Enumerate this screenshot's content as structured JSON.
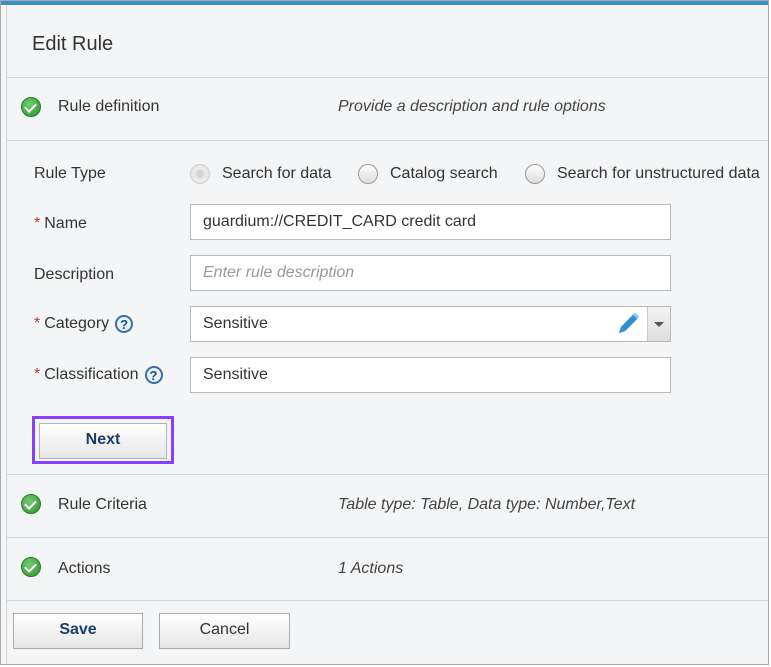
{
  "dialog": {
    "title": "Edit Rule"
  },
  "sections": [
    {
      "label": "Rule definition",
      "description": "Provide a description and rule options"
    },
    {
      "label": "Rule Criteria",
      "description": "Table type: Table, Data type: Number,Text"
    },
    {
      "label": "Actions",
      "description": "1 Actions"
    }
  ],
  "form": {
    "rule_type": {
      "label": "Rule Type",
      "options": [
        "Search for data",
        "Catalog search",
        "Search for unstructured data"
      ],
      "selected": "Search for data"
    },
    "name": {
      "label": "Name",
      "required_mark": "*",
      "value": "guardium://CREDIT_CARD credit card"
    },
    "description": {
      "label": "Description",
      "placeholder": "Enter rule description",
      "value": ""
    },
    "category": {
      "label": "Category",
      "required_mark": "*",
      "value": "Sensitive",
      "help": "?"
    },
    "classification": {
      "label": "Classification",
      "required_mark": "*",
      "value": "Sensitive",
      "help": "?"
    },
    "next_label": "Next"
  },
  "footer": {
    "save_label": "Save",
    "cancel_label": "Cancel"
  },
  "colors": {
    "accent_bar": "#3b8fc4",
    "highlight": "#8a3ffc",
    "check": "#3a9a3a",
    "required": "#c0392b"
  }
}
